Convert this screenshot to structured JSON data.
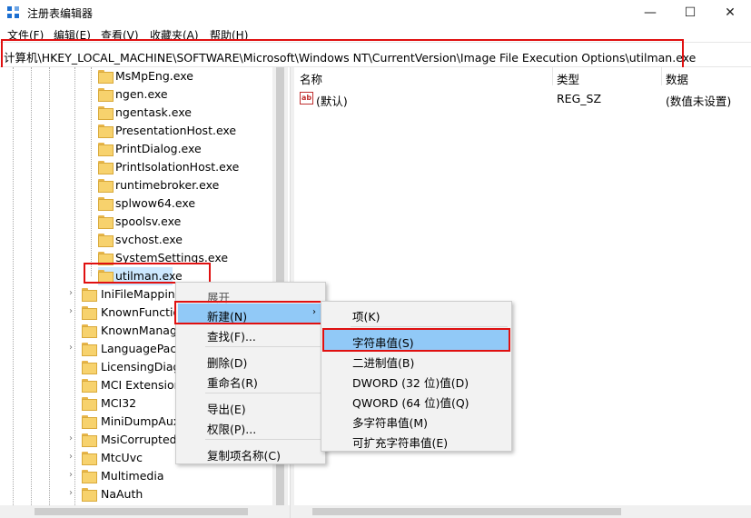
{
  "window": {
    "title": "注册表编辑器",
    "minimize": "—",
    "maximize": "☐",
    "close": "✕"
  },
  "menu": [
    "文件(F)",
    "编辑(E)",
    "查看(V)",
    "收藏夹(A)",
    "帮助(H)"
  ],
  "address": "计算机\\HKEY_LOCAL_MACHINE\\SOFTWARE\\Microsoft\\Windows NT\\CurrentVersion\\Image File Execution Options\\utilman.exe",
  "tree": {
    "subkeys": [
      "MsMpEng.exe",
      "ngen.exe",
      "ngentask.exe",
      "PresentationHost.exe",
      "PrintDialog.exe",
      "PrintIsolationHost.exe",
      "runtimebroker.exe",
      "splwow64.exe",
      "spoolsv.exe",
      "svchost.exe",
      "SystemSettings.exe",
      "utilman.exe"
    ],
    "keys": [
      "IniFileMapping",
      "KnownFunctio",
      "KnownManage",
      "LanguagePack",
      "LicensingDiag",
      "MCI Extension",
      "MCI32",
      "MiniDumpAux",
      "MsiCorrupted",
      "MtcUvc",
      "Multimedia",
      "NaAuth"
    ]
  },
  "values_pane": {
    "columns": [
      "名称",
      "类型",
      "数据"
    ],
    "rows": [
      {
        "name": "(默认)",
        "type": "REG_SZ",
        "data": "(数值未设置)"
      }
    ]
  },
  "context_menu": {
    "expand": "展开",
    "new": "新建(N)",
    "find": "查找(F)...",
    "delete": "删除(D)",
    "rename": "重命名(R)",
    "export": "导出(E)",
    "permissions": "权限(P)...",
    "copy_key_name": "复制项名称(C)",
    "arrow": "›"
  },
  "submenu": {
    "key": "项(K)",
    "string": "字符串值(S)",
    "binary": "二进制值(B)",
    "dword": "DWORD (32 位)值(D)",
    "qword": "QWORD (64 位)值(Q)",
    "multi_string": "多字符串值(M)",
    "expand_string": "可扩充字符串值(E)"
  },
  "colors": {
    "highlight": "#91c9f7",
    "annotation_red": "#e01010",
    "folder": "#f7d26d"
  }
}
